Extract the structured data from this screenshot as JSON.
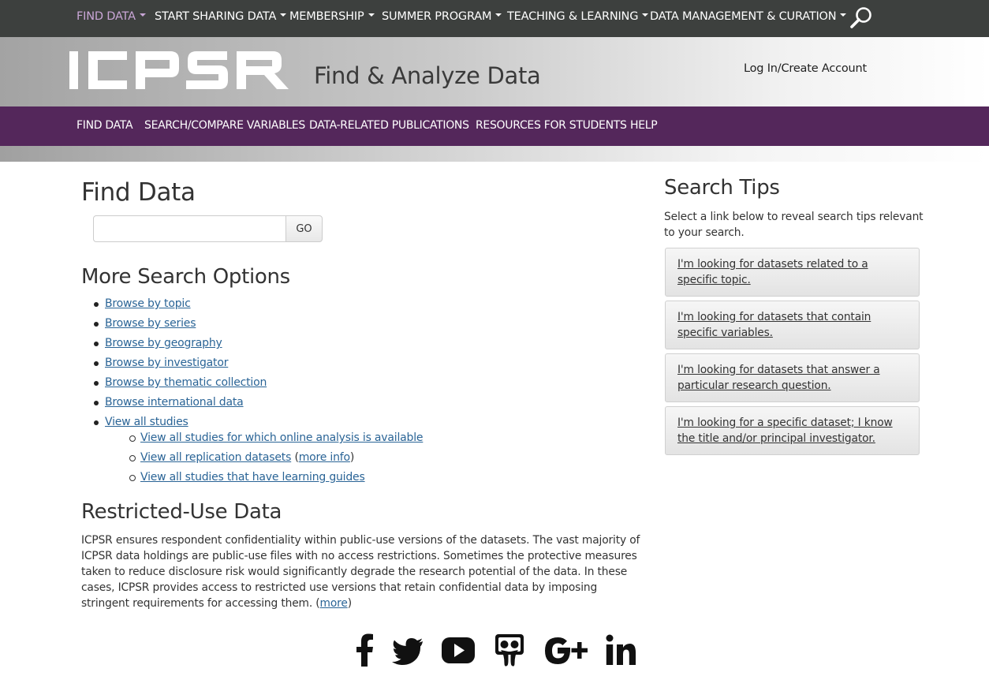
{
  "topnav": {
    "items": [
      {
        "label": "FIND DATA"
      },
      {
        "label": "START SHARING DATA"
      },
      {
        "label": "MEMBERSHIP"
      },
      {
        "label": "SUMMER PROGRAM"
      },
      {
        "label": "TEACHING & LEARNING"
      },
      {
        "label": "DATA MANAGEMENT & CURATION"
      }
    ],
    "search_icon": "magnifier-icon"
  },
  "header": {
    "logo_text": "ICPSR",
    "title": "Find & Analyze Data",
    "login": "Log In/Create Account"
  },
  "subnav": {
    "items": [
      {
        "label": "FIND DATA"
      },
      {
        "label": "SEARCH/COMPARE VARIABLES"
      },
      {
        "label": "DATA-RELATED PUBLICATIONS"
      },
      {
        "label": "RESOURCES FOR STUDENTS"
      },
      {
        "label": "HELP"
      }
    ]
  },
  "main": {
    "find_title": "Find Data",
    "search_value": "",
    "go_label": "GO",
    "more_title": "More Search Options",
    "options": [
      {
        "label": "Browse by topic"
      },
      {
        "label": "Browse by series"
      },
      {
        "label": "Browse by geography"
      },
      {
        "label": "Browse by investigator"
      },
      {
        "label": "Browse by thematic collection"
      },
      {
        "label": "Browse international data"
      },
      {
        "label": "View all studies"
      }
    ],
    "sub_options": [
      {
        "label": "View all studies for which online analysis is available"
      },
      {
        "label": "View all replication datasets",
        "extra_open": "(",
        "extra_link": "more info",
        "extra_close": ")"
      },
      {
        "label": "View all studies that have learning guides"
      }
    ],
    "restricted_title": "Restricted-Use Data",
    "restricted_text": "ICPSR ensures respondent confidentiality within public-use versions of the datasets. The vast majority of ICPSR data holdings are public-use files with no access restrictions. Sometimes the protective measures taken to reduce disclosure risk would significantly degrade the research potential of the data. In these cases, ICPSR provides access to restricted use versions that retain confidential data by imposing stringent requirements for accessing them. (",
    "restricted_more": "more",
    "restricted_close": ")"
  },
  "social": [
    "facebook-icon",
    "twitter-icon",
    "youtube-icon",
    "slideshare-icon",
    "google-plus-icon",
    "linkedin-icon"
  ],
  "sidebar": {
    "title": "Search Tips",
    "intro": "Select a link below to reveal search tips relevant to your search.",
    "tips": [
      {
        "label": "I'm looking for datasets related to a specific topic."
      },
      {
        "label": "I'm looking for datasets that contain specific variables."
      },
      {
        "label": "I'm looking for datasets that answer a particular research question."
      },
      {
        "label": "I'm looking for a specific dataset; I know the title and/or principal investigator."
      }
    ]
  },
  "colors": {
    "topnav_bg": "#3d403e",
    "topnav_active": "#c9a6d6",
    "subnav_bg": "#54275b",
    "link": "#2a6496"
  }
}
